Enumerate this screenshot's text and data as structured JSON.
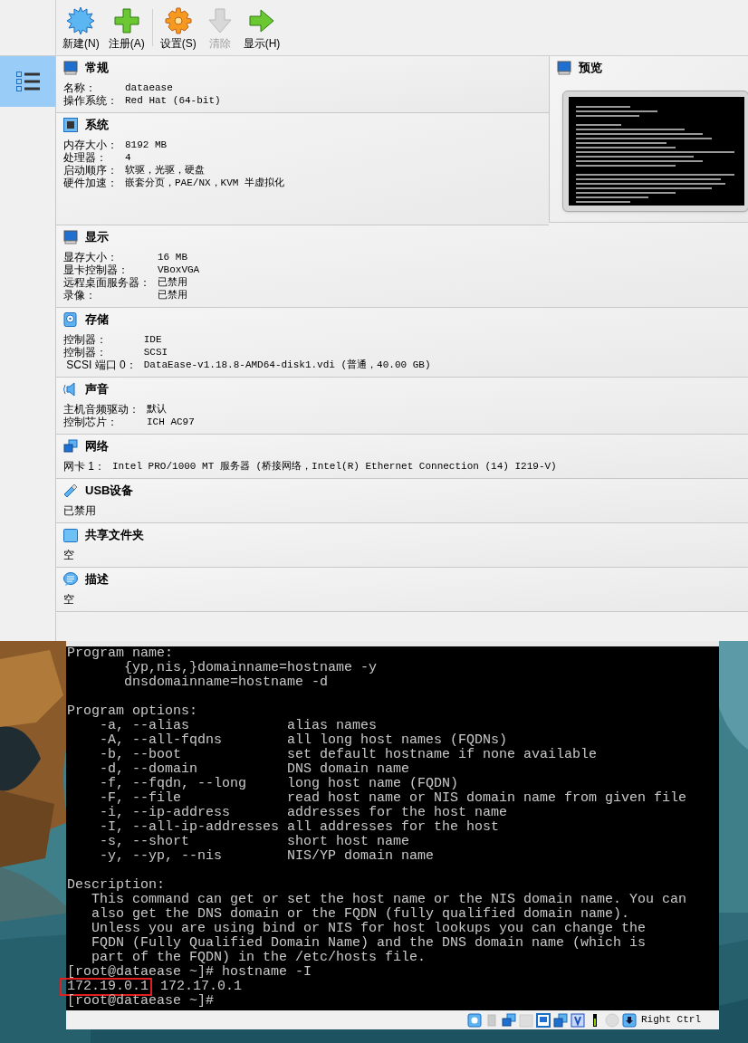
{
  "toolbar": [
    {
      "label": "新建(N)",
      "disabled": false
    },
    {
      "label": "注册(A)",
      "disabled": false
    },
    {
      "label": "设置(S)",
      "disabled": false
    },
    {
      "label": "清除",
      "disabled": true
    },
    {
      "label": "显示(H)",
      "disabled": false
    }
  ],
  "sidebar": {
    "items": [
      {
        "selected": true
      }
    ]
  },
  "sections": [
    {
      "title": "常规",
      "rows": [
        {
          "label": "名称：",
          "value": "dataease"
        },
        {
          "label": "操作系统：",
          "value": "Red Hat (64-bit)"
        }
      ]
    },
    {
      "title": "系统",
      "rows": [
        {
          "label": "内存大小：",
          "value": "8192 MB"
        },
        {
          "label": "处理器：",
          "value": "4"
        },
        {
          "label": "启动顺序：",
          "value": "软驱，光驱，硬盘"
        },
        {
          "label": "硬件加速：",
          "value": "嵌套分页，PAE/NX，KVM 半虚拟化"
        }
      ]
    },
    {
      "title": "显示",
      "rows": [
        {
          "label": "显存大小：",
          "value": "16 MB"
        },
        {
          "label": "显卡控制器：",
          "value": "VBoxVGA"
        },
        {
          "label": "远程桌面服务器：",
          "value": "已禁用"
        },
        {
          "label": "录像：",
          "value": "已禁用"
        }
      ]
    },
    {
      "title": "存储",
      "rows": [
        {
          "label": "控制器：",
          "value": "IDE"
        },
        {
          "label": "控制器：",
          "value": "SCSI"
        },
        {
          "label": " SCSI 端口 0：",
          "value": "DataEase-v1.18.8-AMD64-disk1.vdi (普通，40.00 GB)"
        }
      ]
    },
    {
      "title": "声音",
      "rows": [
        {
          "label": "主机音频驱动：",
          "value": "默认"
        },
        {
          "label": "控制芯片：",
          "value": "ICH AC97"
        }
      ]
    },
    {
      "title": "网络",
      "rows": [
        {
          "label": "网卡 1：",
          "value": "Intel PRO/1000 MT 服务器 (桥接网络，Intel(R) Ethernet Connection (14) I219-V)"
        }
      ]
    },
    {
      "title": "USB设备",
      "rows": [
        {
          "value": "已禁用"
        }
      ]
    },
    {
      "title": "共享文件夹",
      "rows": [
        {
          "value": "空"
        }
      ]
    },
    {
      "title": "描述",
      "rows": [
        {
          "value": "空"
        }
      ]
    }
  ],
  "preview": {
    "title": "预览"
  },
  "terminal": {
    "blocks": [
      [
        "Program name:",
        "       {yp,nis,}domainname=hostname -y",
        "       dnsdomainname=hostname -d"
      ],
      [
        "Program options:",
        "    -a, --alias            alias names",
        "    -A, --all-fqdns        all long host names (FQDNs)",
        "    -b, --boot             set default hostname if none available",
        "    -d, --domain           DNS domain name",
        "    -f, --fqdn, --long     long host name (FQDN)",
        "    -F, --file             read host name or NIS domain name from given file",
        "    -i, --ip-address       addresses for the host name",
        "    -I, --all-ip-addresses all addresses for the host",
        "    -s, --short            short host name",
        "    -y, --yp, --nis        NIS/YP domain name"
      ],
      [
        "Description:",
        "   This command can get or set the host name or the NIS domain name. You can",
        "   also get the DNS domain or the FQDN (fully qualified domain name).",
        "   Unless you are using bind or NIS for host lookups you can change the",
        "   FQDN (Fully Qualified Domain Name) and the DNS domain name (which is",
        "   part of the FQDN) in the /etc/hosts file.",
        "[root@dataease ~]# hostname -I",
        {
          "boxed": "172.19.0.1",
          "text": " 172.17.0.1"
        },
        "[root@dataease ~]#"
      ]
    ]
  },
  "status_bar": {
    "host_key": "Right Ctrl"
  }
}
